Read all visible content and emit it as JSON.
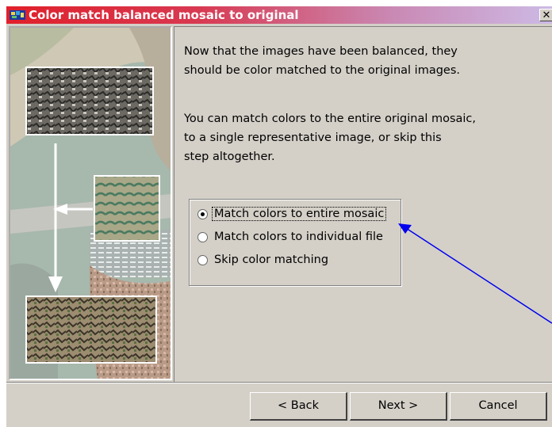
{
  "window": {
    "title": "Color match balanced mosaic to original",
    "close_label": "✕"
  },
  "content": {
    "intro_lines": [
      "Now that the images have been balanced, they",
      "should be color matched to the original images."
    ],
    "detail_lines": [
      "You can match colors to the entire original mosaic,",
      "to a single representative image, or skip this",
      "step altogether."
    ],
    "options": [
      {
        "label": "Match colors to entire mosaic",
        "selected": true
      },
      {
        "label": "Match colors to individual file",
        "selected": false
      },
      {
        "label": "Skip color matching",
        "selected": false
      }
    ]
  },
  "buttons": {
    "back": "< Back",
    "next": "Next >",
    "cancel": "Cancel"
  },
  "colors": {
    "annotation_arrow": "#0000ee",
    "title_gradient_start": "#e0202a",
    "dialog_face": "#d4d0c8"
  }
}
